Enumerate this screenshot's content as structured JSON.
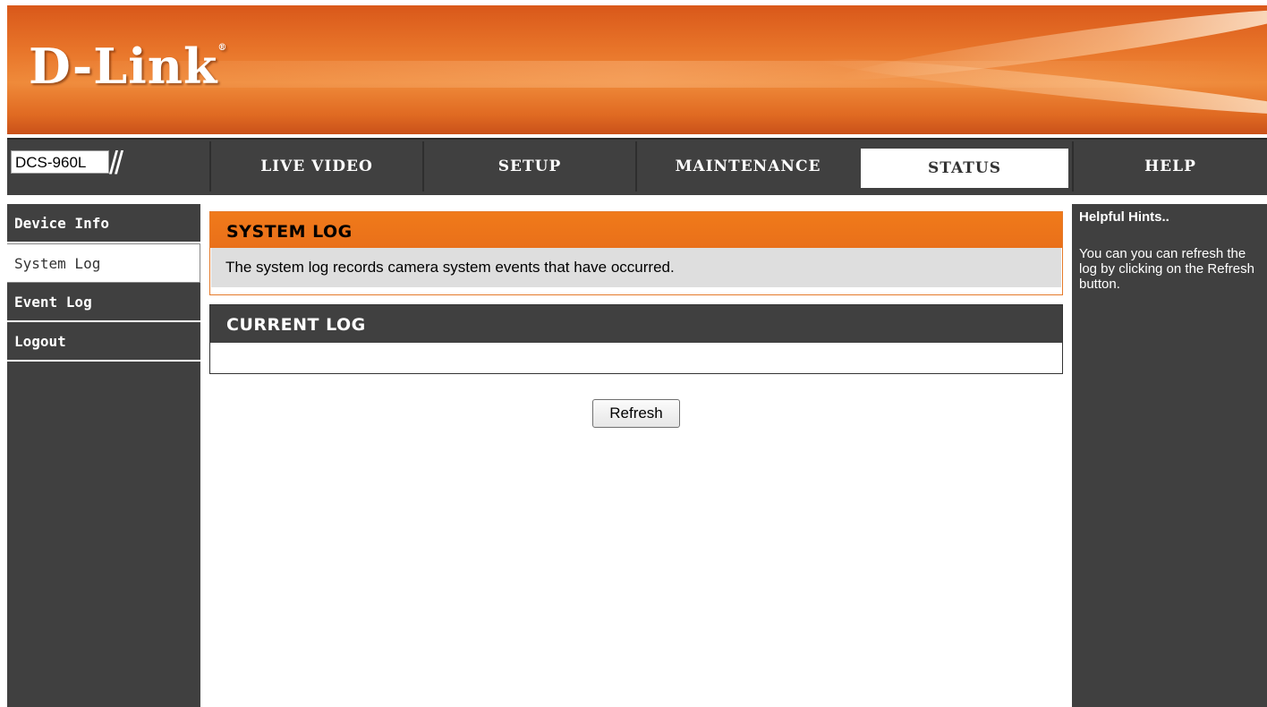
{
  "brand": {
    "logo_text": "D-Link",
    "trademark": "®"
  },
  "header": {
    "model": "DCS-960L",
    "model_suffix": "//"
  },
  "nav": {
    "tabs": [
      {
        "label": "LIVE VIDEO"
      },
      {
        "label": "SETUP"
      },
      {
        "label": "MAINTENANCE"
      },
      {
        "label": "STATUS",
        "active": true
      },
      {
        "label": "HELP"
      }
    ]
  },
  "sidebar": {
    "items": [
      {
        "label": "Device Info"
      },
      {
        "label": "System Log",
        "active": true
      },
      {
        "label": "Event Log"
      },
      {
        "label": "Logout"
      }
    ]
  },
  "main": {
    "system_log": {
      "title": "SYSTEM LOG",
      "description": "The system log records camera system events that have occurred."
    },
    "current_log": {
      "title": "CURRENT LOG",
      "content": ""
    },
    "refresh_label": "Refresh"
  },
  "hints": {
    "title": "Helpful Hints..",
    "text": "You can you can refresh the log by clicking on the Refresh button."
  },
  "colors": {
    "accent_orange": "#f07a1a",
    "dark_gray": "#404040",
    "light_gray": "#dedede"
  }
}
